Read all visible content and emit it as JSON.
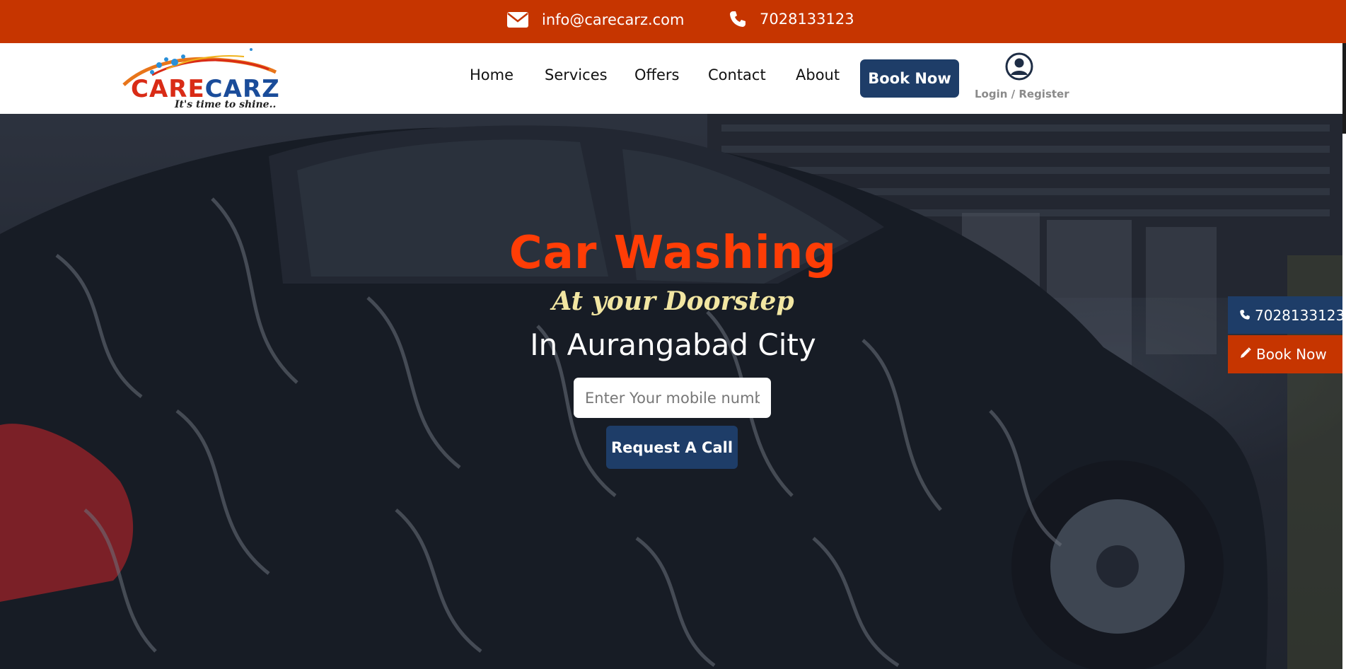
{
  "topbar": {
    "email": "info@carecarz.com",
    "phone": "7028133123",
    "bg_color": "#c63500",
    "email_icon": "envelope-icon",
    "phone_icon": "phone-icon"
  },
  "logo": {
    "text_part1": "CARE",
    "text_part2": "CARZ",
    "tagline": "It's time to shine.."
  },
  "nav": {
    "items": [
      {
        "label": "Home"
      },
      {
        "label": "Services"
      },
      {
        "label": "Offers"
      },
      {
        "label": "Contact"
      },
      {
        "label": "About"
      }
    ],
    "book_label": "Book Now",
    "login_label": "Login / Register",
    "login_icon": "user-circle-icon",
    "accent_color": "#1e3d68"
  },
  "hero": {
    "title": "Car Washing",
    "subtitle": "At your Doorstep",
    "city": "In Aurangabad City",
    "input_placeholder": "Enter Your mobile number",
    "request_label": "Request A Call",
    "title_color": "#ff3d06"
  },
  "sidebar_float": {
    "phone": "7028133123",
    "book_label": "Book Now",
    "phone_icon": "phone-icon",
    "book_icon": "pencil-icon"
  }
}
